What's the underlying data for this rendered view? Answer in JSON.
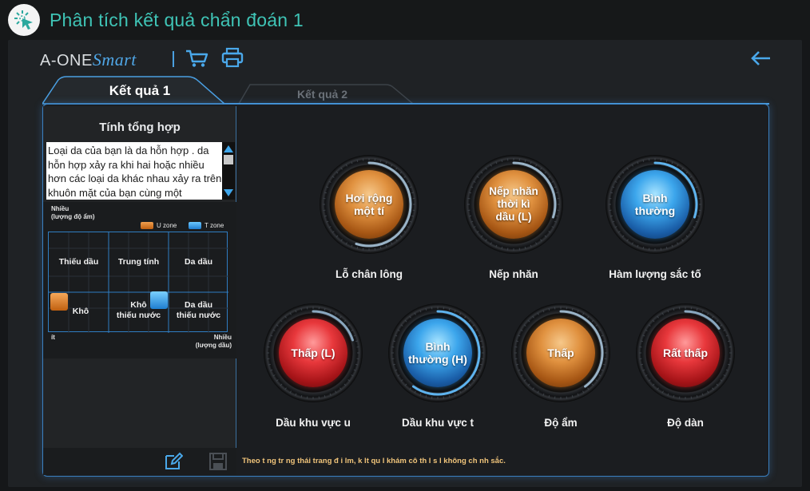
{
  "window": {
    "title": "Phân tích kết quả chẩn đoán 1"
  },
  "brand": {
    "name": "A-ONE",
    "suffix": "Smart"
  },
  "tabs": [
    {
      "label": "Kết quả 1",
      "active": true
    },
    {
      "label": "Kết quả 2",
      "active": false
    }
  ],
  "summary": {
    "title": "Tính tổng hợp",
    "text": "Loại da của bạn là da hỗn hợp . da hỗn hợp xảy ra khi hai hoặc nhiều hơn các loại da khác nhau xảy ra trên khuôn mặt của bạn cùng một"
  },
  "skin_chart": {
    "y_top": "Nhiều\n(lượng độ ẩm)",
    "legend_u": "U zone",
    "legend_t": "T zone",
    "cells": {
      "top_left": "Thiếu dầu",
      "top_mid": "Trung tính",
      "top_right": "Da dầu",
      "bot_left": "Khô",
      "bot_mid": "Khô\nthiếu nước",
      "bot_right": "Da dầu\nthiếu nước"
    },
    "x_left": "ít",
    "x_right": "Nhiều\n(lượng dầu)",
    "u_zone_cell": "Khô",
    "t_zone_cell": "Khô\nthiếu nước"
  },
  "dials": [
    {
      "value": "Hơi rộng\nmột tí",
      "caption": "Lỗ chân lông",
      "color": "orange",
      "level": 0.55
    },
    {
      "value": "Nếp nhăn\nthời kì\ndầu (L)",
      "caption": "Nếp nhăn",
      "color": "orange",
      "level": 0.3
    },
    {
      "value": "Bình\nthường",
      "caption": "Hàm lượng sắc tố",
      "color": "blue",
      "level": 0.3
    },
    {
      "value": "Thấp (L)",
      "caption": "Dầu khu vực u",
      "color": "red",
      "level": 0.2
    },
    {
      "value": "Bình\nthường (H)",
      "caption": "Dầu khu vực t",
      "color": "blue",
      "level": 0.6
    },
    {
      "value": "Thấp",
      "caption": "Độ ẩm",
      "color": "orange",
      "level": 0.4
    },
    {
      "value": "Rất thấp",
      "caption": "Độ dàn",
      "color": "red",
      "level": 0.15
    }
  ],
  "footnote": "Theo t ng tr ng thái trang  đ i lm, k lt qu l khám cô th l s l không ch nh sắc.",
  "colors": {
    "accent": "#4a9fe2",
    "title": "#3fc4b6",
    "footnote": "#f0c47a"
  }
}
